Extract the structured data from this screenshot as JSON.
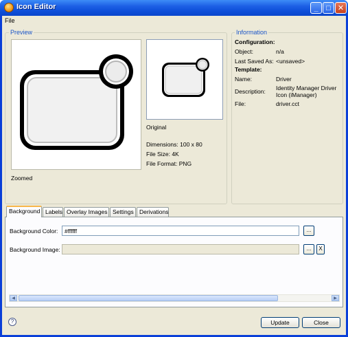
{
  "window": {
    "title": "Icon Editor",
    "minimize": "_",
    "maximize": "□",
    "close": "✕"
  },
  "menu": {
    "file": "File"
  },
  "preview": {
    "legend": "Preview",
    "zoomed_label": "Zoomed",
    "original_label": "Original",
    "dimensions": "Dimensions: 100 x 80",
    "file_size": "File Size: 4K",
    "file_format": "File Format: PNG"
  },
  "information": {
    "legend": "Information",
    "configuration_heading": "Configuration:",
    "object_label": "Object:",
    "object_value": "n/a",
    "last_saved_label": "Last Saved As:",
    "last_saved_value": "<unsaved>",
    "template_heading": "Template:",
    "name_label": "Name:",
    "name_value": "Driver",
    "description_label": "Description:",
    "description_line1": "Identity Manager Driver",
    "description_line2": "Icon (iManager)",
    "file_label": "File:",
    "file_value": "driver.cct"
  },
  "tabs": [
    "Background",
    "Labels",
    "Overlay Images",
    "Settings",
    "Derivations"
  ],
  "background": {
    "color_label": "Background Color:",
    "color_value": "#ffffff",
    "image_label": "Background Image:",
    "image_value": "",
    "browse": "...",
    "clear": "X"
  },
  "buttons": {
    "help": "?",
    "update": "Update",
    "close": "Close"
  }
}
